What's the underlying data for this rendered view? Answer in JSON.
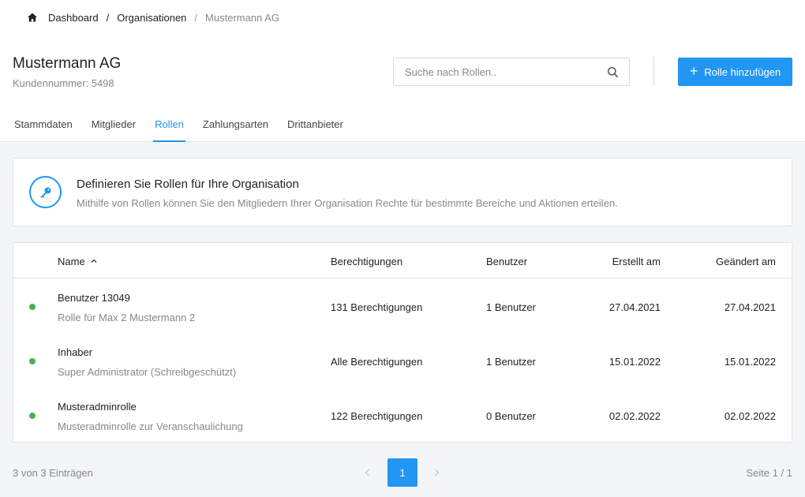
{
  "breadcrumb": {
    "home_icon": "home-icon",
    "items": [
      "Dashboard",
      "Organisationen",
      "Mustermann AG"
    ],
    "separator": "/"
  },
  "organization": {
    "name": "Mustermann AG",
    "customer_number": "Kundennummer: 5498"
  },
  "search": {
    "placeholder": "Suche nach Rollen..",
    "value": "",
    "icon": "search-icon"
  },
  "actions": {
    "add_role_label": "Rolle hinzufügen",
    "add_role_icon": "plus-icon"
  },
  "tabs": [
    {
      "label": "Stammdaten",
      "active": false
    },
    {
      "label": "Mitglieder",
      "active": false
    },
    {
      "label": "Rollen",
      "active": true
    },
    {
      "label": "Zahlungsarten",
      "active": false
    },
    {
      "label": "Drittanbieter",
      "active": false
    }
  ],
  "info": {
    "icon": "key-icon",
    "title": "Definieren Sie Rollen für Ihre Organisation",
    "text": "Mithilfe von Rollen können Sie den Mitgliedern Ihrer Organisation Rechte für bestimmte Bereiche und Aktionen erteilen."
  },
  "table": {
    "headers": {
      "name": "Name",
      "permissions": "Berechtigungen",
      "users": "Benutzer",
      "created": "Erstellt am",
      "changed": "Geändert am"
    },
    "sort": {
      "column": "name",
      "direction": "asc",
      "icon": "chevron-up-icon"
    },
    "rows": [
      {
        "status": "active",
        "status_color": "#4caf50",
        "name": "Benutzer 13049",
        "description": "Rolle für Max 2 Mustermann 2",
        "permissions": "131 Berechtigungen",
        "users": "1 Benutzer",
        "created": "27.04.2021",
        "changed": "27.04.2021"
      },
      {
        "status": "active",
        "status_color": "#4caf50",
        "name": "Inhaber",
        "description": "Super Administrator (Schreibgeschützt)",
        "permissions": "Alle Berechtigungen",
        "users": "1 Benutzer",
        "created": "15.01.2022",
        "changed": "15.01.2022"
      },
      {
        "status": "active",
        "status_color": "#4caf50",
        "name": "Musteradminrolle",
        "description": "Musteradminrolle zur Veranschaulichung",
        "permissions": "122 Berechtigungen",
        "users": "0 Benutzer",
        "created": "02.02.2022",
        "changed": "02.02.2022"
      }
    ]
  },
  "pagination": {
    "summary": "3 von 3 Einträgen",
    "current_page": "1",
    "page_info": "Seite 1 / 1",
    "prev_icon": "chevron-left-icon",
    "next_icon": "chevron-right-icon"
  },
  "colors": {
    "accent": "#2196f3",
    "status_active": "#4caf50"
  }
}
